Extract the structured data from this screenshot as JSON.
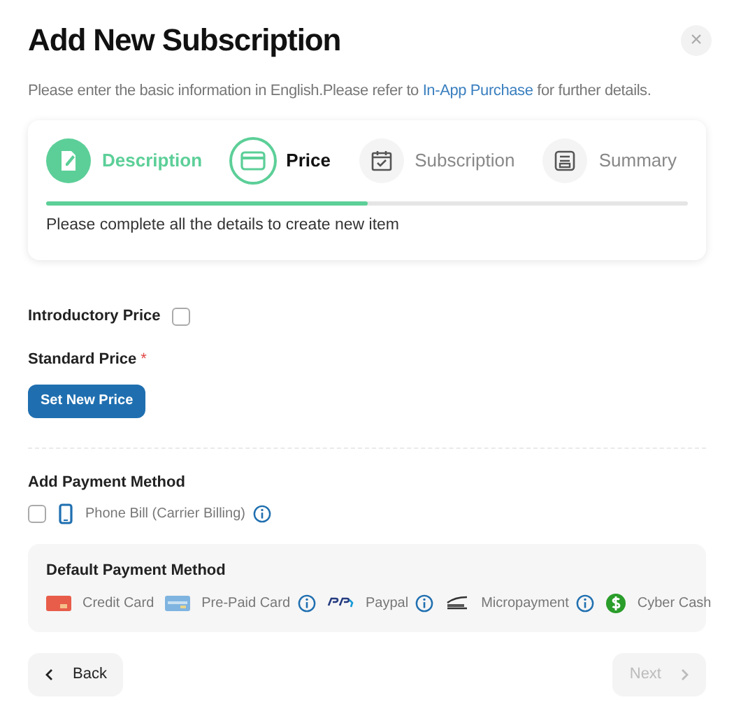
{
  "dialog": {
    "title": "Add New Subscription",
    "close": "×",
    "intro_before": "Please enter the basic information in English.Please refer to ",
    "intro_link": "In-App Purchase",
    "intro_after": " for further details."
  },
  "steps": [
    {
      "label": "Description",
      "done": true,
      "selected": false,
      "kind": "document"
    },
    {
      "label": "Price",
      "done": false,
      "selected": true,
      "kind": "card"
    },
    {
      "label": "Subscription",
      "done": false,
      "selected": false,
      "kind": "calendar"
    },
    {
      "label": "Summary",
      "done": false,
      "selected": false,
      "kind": "summary"
    }
  ],
  "progress": {
    "level": 0.5,
    "hint": "Please complete all the details to create new item"
  },
  "introductory_price": {
    "label": "Introductory Price",
    "checked": false
  },
  "standard_price": {
    "label": "Standard Price",
    "required_mark": "*",
    "button": "Set New Price"
  },
  "add_payment_method": {
    "title": "Add Payment Method",
    "options": [
      {
        "label": "Phone Bill (Carrier Billing)",
        "checked": false,
        "kind": "phone",
        "info": true
      }
    ]
  },
  "default_payment_method": {
    "title": "Default Payment Method",
    "methods": [
      {
        "label": "Credit Card",
        "kind": "credit",
        "info": false
      },
      {
        "label": "Pre-Paid Card",
        "kind": "prepaid",
        "info": true
      },
      {
        "label": "Paypal",
        "kind": "paypal",
        "info": true
      },
      {
        "label": "Micropayment",
        "kind": "micro",
        "info": true
      },
      {
        "label": "Cyber Cash",
        "kind": "cash",
        "info": false
      }
    ]
  },
  "footer": {
    "back": {
      "label": "Back",
      "disabled": false
    },
    "next": {
      "label": "Next",
      "disabled": true
    }
  }
}
